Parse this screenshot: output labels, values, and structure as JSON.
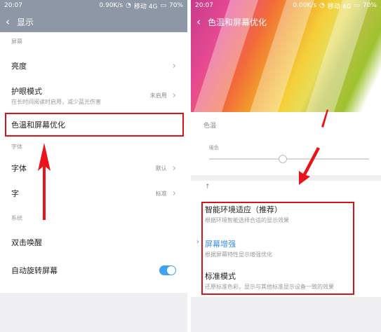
{
  "left": {
    "status": {
      "time": "20:07",
      "speed": "0.90K/s",
      "carrier": "移动 4G",
      "battery": "70%"
    },
    "title": "显示",
    "section_screen": "屏幕",
    "items": {
      "brightness": "亮度",
      "eye_care": "护眼模式",
      "eye_care_sub": "在长时间阅读时启用，减少蓝光伤害",
      "eye_care_value": "未启用",
      "color_temp": "色温和屏幕优化"
    },
    "section_font": "字体",
    "font_item": "字体",
    "font_value": "默认",
    "font_size_item": "字",
    "font_size_value": "标准",
    "section_system": "系统",
    "double_tap": "双击唤醒",
    "auto_rotate": "自动旋转屏幕",
    "auto_rotate_on": true,
    "highlight_color": "#d6141a"
  },
  "right": {
    "status": {
      "time": "20:07",
      "speed": "0.00K/s",
      "carrier": "移动 4G",
      "battery": "70%"
    },
    "title": "色温和屏幕优化",
    "color_temp_label": "色温",
    "slider_label": "暖色",
    "slider_value": 0.46,
    "options": [
      {
        "label": "智能环境适应（推荐）",
        "desc": "根据环境智能选择合适的显示效果"
      },
      {
        "label": "屏幕增强",
        "desc": "根据屏幕特性显示增强优化",
        "selected": true
      },
      {
        "label": "标准模式",
        "desc": "还原标准色彩，显示与其他标准显示设备一致的效果"
      }
    ],
    "selected_color": "#3a8ee6",
    "highlight_color": "#d6141a"
  }
}
